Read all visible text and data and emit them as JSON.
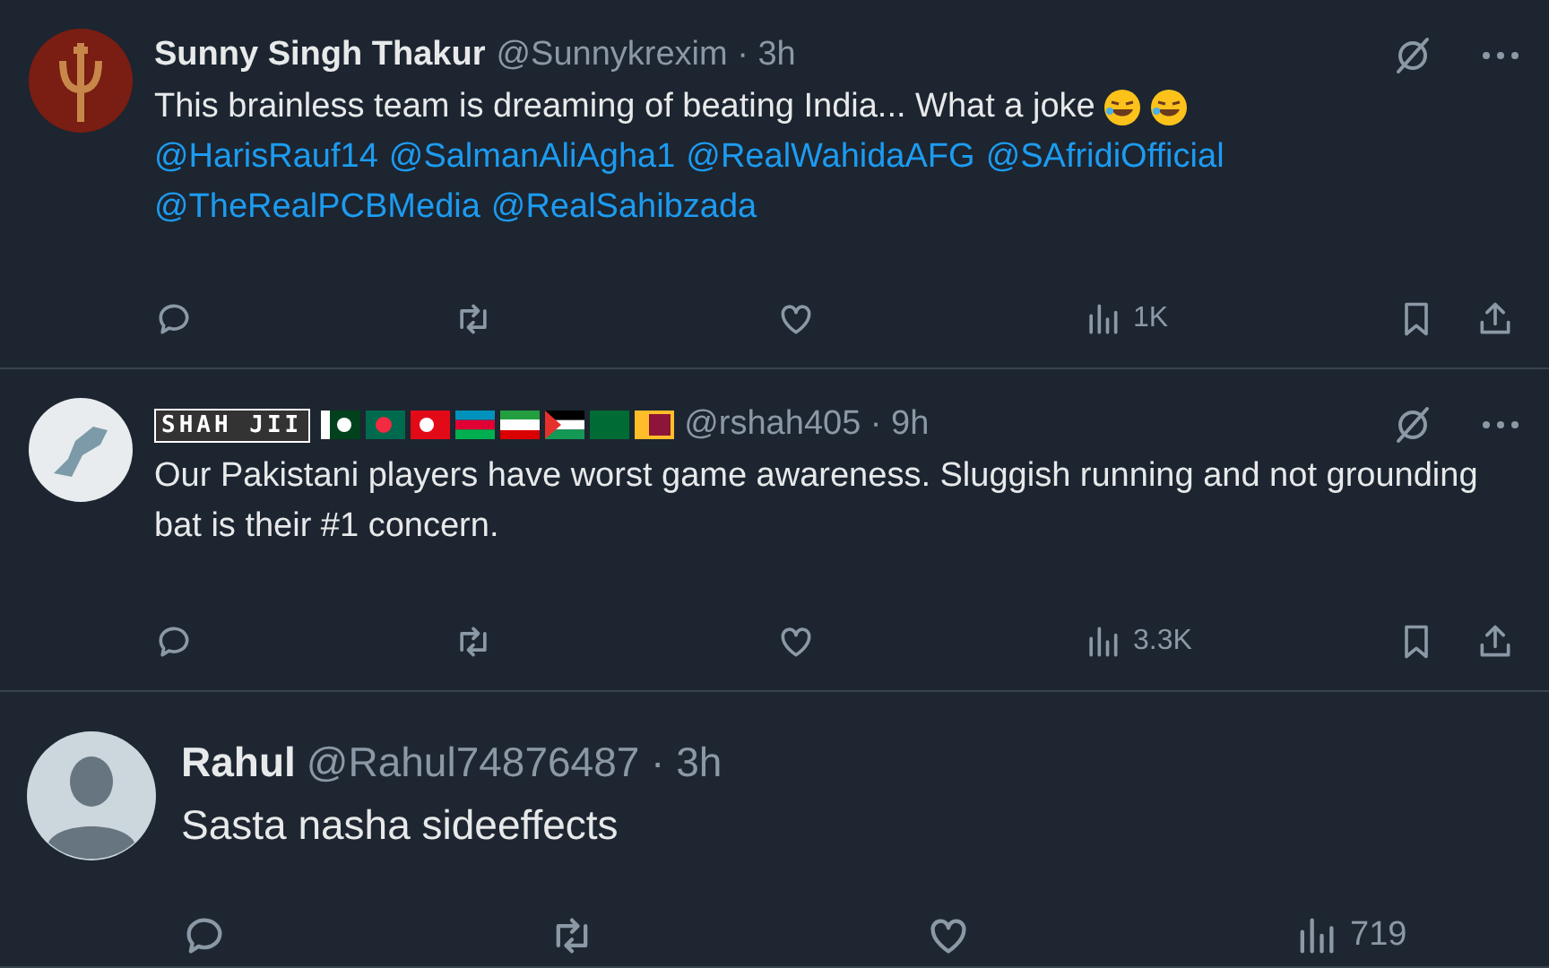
{
  "tweets": [
    {
      "kind": "normal",
      "name": "Sunny Singh Thakur",
      "flags": false,
      "byline": "@Sunnykrexim · 3h",
      "text": "This brainless team is dreaming of beating India... What a joke",
      "trailing_emoji": true,
      "mentions": [
        "@HarisRauf14",
        "@SalmanAliAgha1",
        "@RealWahidaAFG",
        "@SAfridiOfficial",
        "@TheRealPCBMedia",
        "@RealSahibzada"
      ],
      "grok": true,
      "views": "1K",
      "bookmark": true
    },
    {
      "kind": "normal",
      "name": "SHAH JII",
      "flags": true,
      "byline": "@rshah405 · 9h",
      "text": "Our Pakistani players have worst game awareness. Sluggish running and not grounding bat is their #1 concern.",
      "trailing_emoji": false,
      "grok": true,
      "views": "3.3K",
      "bookmark": true
    },
    {
      "kind": "large",
      "name": "Rahul",
      "flags": false,
      "byline": "@Rahul74876487 · 3h",
      "text": "Sasta nasha sideeffects",
      "trailing_emoji": false,
      "grok": false,
      "views": "719",
      "bookmark": false
    }
  ]
}
